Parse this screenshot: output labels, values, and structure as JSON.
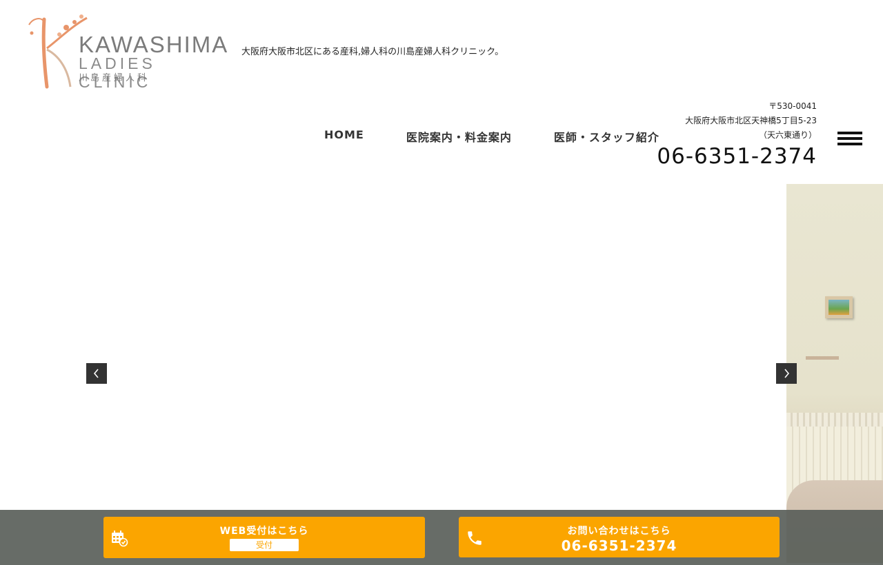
{
  "header": {
    "logo": {
      "word": "KAWASHIMA",
      "sub": "LADIES CLINIC",
      "ja": "川島産婦人科"
    },
    "tagline": "大阪府大阪市北区にある産科,婦人科の川島産婦人科クリニック。"
  },
  "nav": {
    "items": [
      {
        "label": "HOME"
      },
      {
        "label": "医院案内・料金案内"
      },
      {
        "label": "医師・スタッフ紹介"
      }
    ]
  },
  "contact": {
    "postal": "〒530-0041",
    "address": "大阪府大阪市北区天神橋5丁目5-23",
    "address_note": "（天六東通り）",
    "phone": "06-6351-2374"
  },
  "slider": {
    "prev_icon": "chevron-left-icon",
    "next_icon": "chevron-right-icon"
  },
  "bottom_bar": {
    "web": {
      "title": "WEB受付はこちら",
      "badge": "受付",
      "icon": "calendar-check-icon"
    },
    "tel": {
      "title": "お問い合わせはこちら",
      "phone": "06-6351-2374",
      "icon": "phone-icon"
    }
  },
  "colors": {
    "accent": "#fba500",
    "bar": "#5a5f5a",
    "logo_orange": "#e8956a"
  }
}
